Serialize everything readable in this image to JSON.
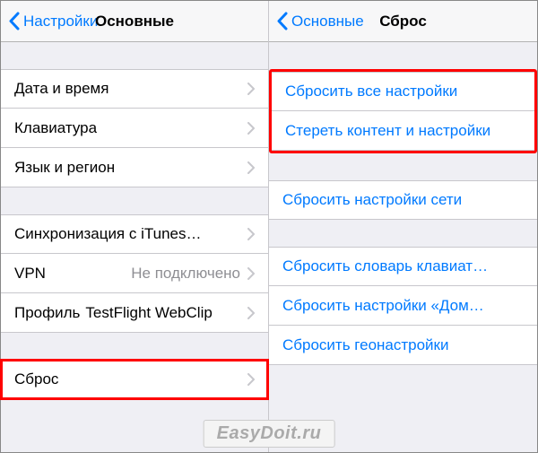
{
  "left": {
    "back": "Настройки",
    "title": "Основные",
    "group1": [
      {
        "label": "Дата и время"
      },
      {
        "label": "Клавиатура"
      },
      {
        "label": "Язык и регион"
      }
    ],
    "group2": [
      {
        "label": "Синхронизация с iTunes…"
      },
      {
        "label": "VPN",
        "value": "Не подключено"
      },
      {
        "label": "Профиль",
        "value": "TestFlight WebClip"
      }
    ],
    "group3": [
      {
        "label": "Сброс"
      }
    ]
  },
  "right": {
    "back": "Основные",
    "title": "Сброс",
    "group1": [
      {
        "label": "Сбросить все настройки"
      },
      {
        "label": "Стереть контент и настройки"
      }
    ],
    "group2": [
      {
        "label": "Сбросить настройки сети"
      }
    ],
    "group3": [
      {
        "label": "Сбросить словарь клавиат…"
      },
      {
        "label": "Сбросить настройки «Дом…"
      },
      {
        "label": "Сбросить геонастройки"
      }
    ]
  },
  "watermark": "EasyDoit.ru"
}
